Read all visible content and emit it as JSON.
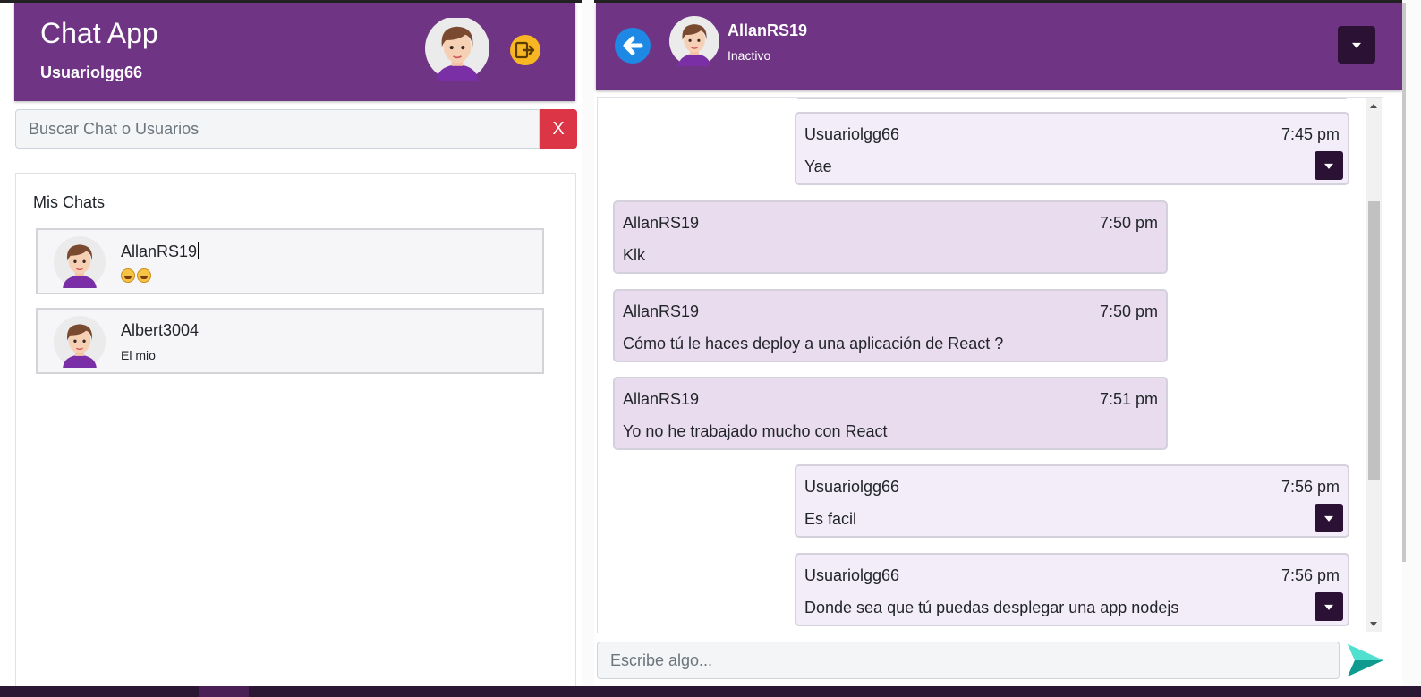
{
  "app": {
    "title": "Chat App",
    "current_user": "Usuariolgg66"
  },
  "search": {
    "placeholder": "Buscar Chat o Usuarios",
    "value": "",
    "clear_label": "X"
  },
  "sidebar": {
    "title": "Mis Chats",
    "chats": [
      {
        "name": "AllanRS19",
        "preview": "😄😄"
      },
      {
        "name": "Albert3004",
        "preview": "El mio"
      }
    ]
  },
  "conversation": {
    "contact_name": "AllanRS19",
    "contact_status": "Inactivo",
    "messages": [
      {
        "author": "Usuariolgg66",
        "time": "7:45 pm",
        "text": "Yae",
        "mine": true
      },
      {
        "author": "AllanRS19",
        "time": "7:50 pm",
        "text": "Klk",
        "mine": false
      },
      {
        "author": "AllanRS19",
        "time": "7:50 pm",
        "text": "Cómo tú le haces deploy a una aplicación de React ?",
        "mine": false
      },
      {
        "author": "AllanRS19",
        "time": "7:51 pm",
        "text": "Yo no he trabajado mucho con React",
        "mine": false
      },
      {
        "author": "Usuariolgg66",
        "time": "7:56 pm",
        "text": "Es facil",
        "mine": true
      },
      {
        "author": "Usuariolgg66",
        "time": "7:56 pm",
        "text": "Donde sea que tú puedas desplegar una app nodejs",
        "mine": true
      }
    ]
  },
  "composer": {
    "placeholder": "Escribe algo...",
    "value": ""
  },
  "icons": {
    "logout": "logout-icon",
    "back": "back-arrow-icon",
    "send": "send-icon",
    "menu": "chevron-down-icon"
  },
  "colors": {
    "header": "#6f3483",
    "dark_button": "#2b1235",
    "danger": "#dc3545",
    "my_bubble": "#f3ecf9",
    "their_bubble": "#eadcef",
    "send": "#18c2b5",
    "back": "#1e88e5",
    "logout": "#f9b623"
  }
}
